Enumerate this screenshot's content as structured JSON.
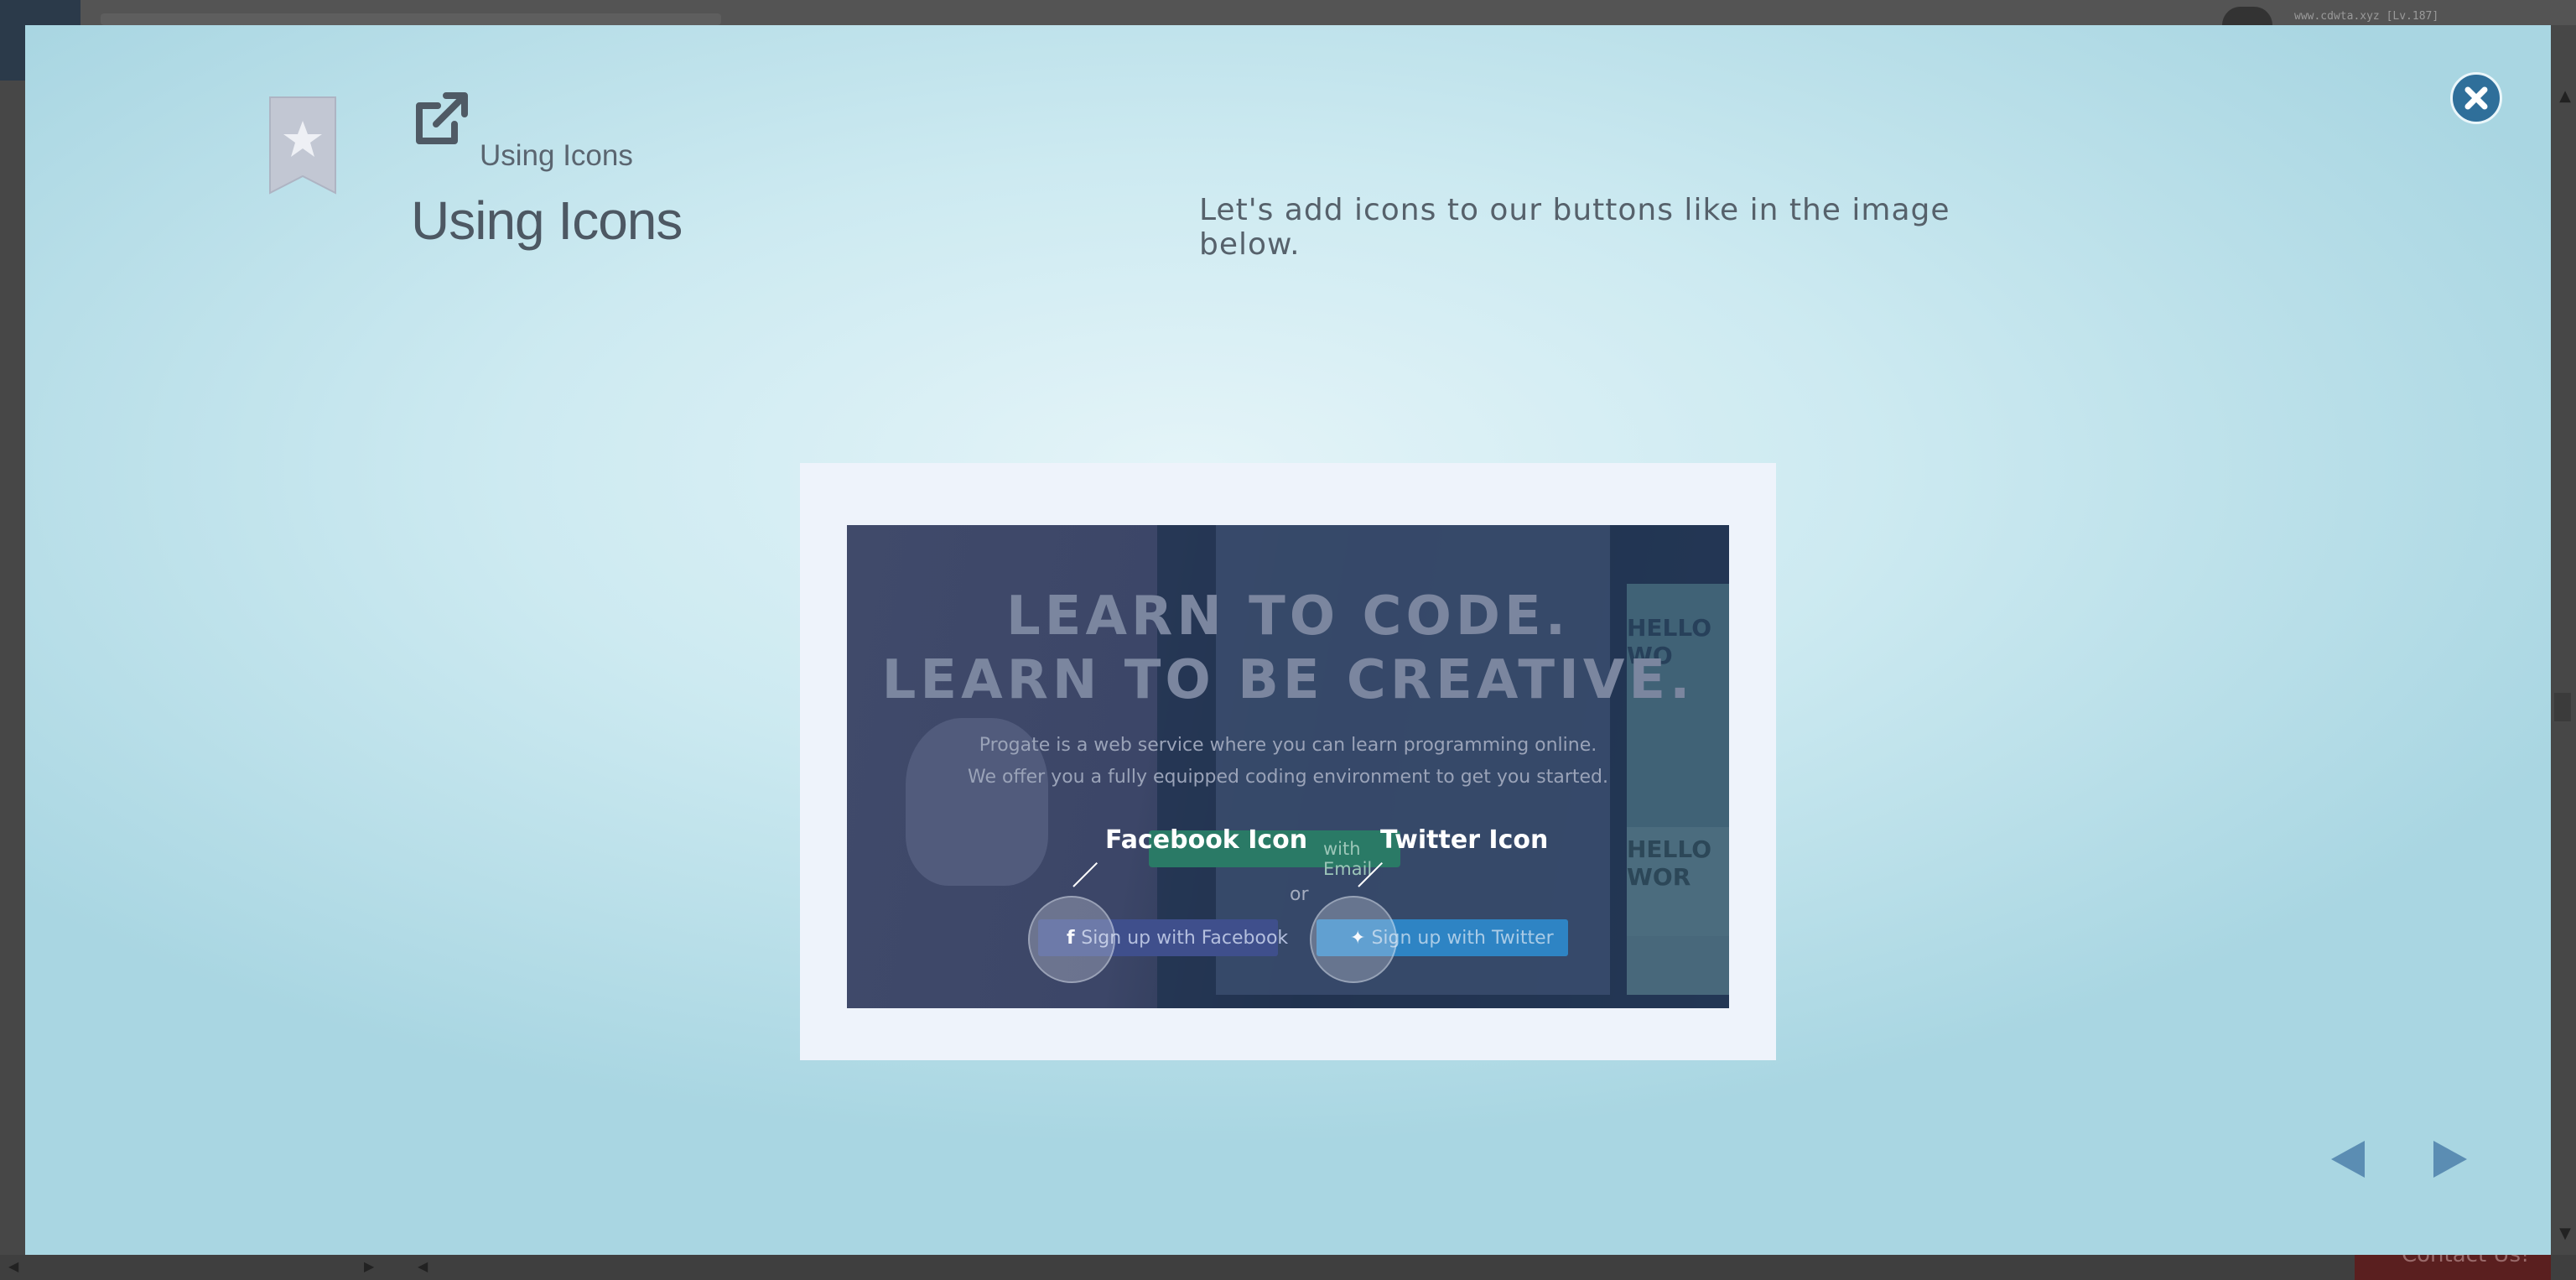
{
  "background": {
    "url_text": "www.cdwta.xyz [Lv.187]",
    "contact_label": "Contact Us!"
  },
  "modal": {
    "section_label": "Using Icons",
    "title": "Using Icons",
    "intro": "Let's add icons to our buttons like in the image below.",
    "icons": {
      "bookmark": "bookmark-star-icon",
      "section": "external-link-icon",
      "close": "close-icon",
      "prev": "triangle-left-icon",
      "next": "triangle-right-icon"
    },
    "colors": {
      "close": "#2f6f9a",
      "nav_arrows": "#5b8db3",
      "bookmark": "#c2c7d3"
    }
  },
  "illustration": {
    "headline_1": "LEARN TO CODE.",
    "headline_2": "LEARN TO BE CREATIVE.",
    "sub_1": "Progate is a web service where you can learn programming online.",
    "sub_2": "We offer you a fully equipped coding environment to get you started.",
    "email_button": "with Email",
    "or": "or",
    "facebook_button": "Sign up with Facebook",
    "twitter_button": "Sign up with Twitter",
    "facebook_annotation": "Facebook Icon",
    "twitter_annotation": "Twitter Icon",
    "side_card_1": "HELLO WO",
    "side_card_2": "HELLO WOR"
  }
}
